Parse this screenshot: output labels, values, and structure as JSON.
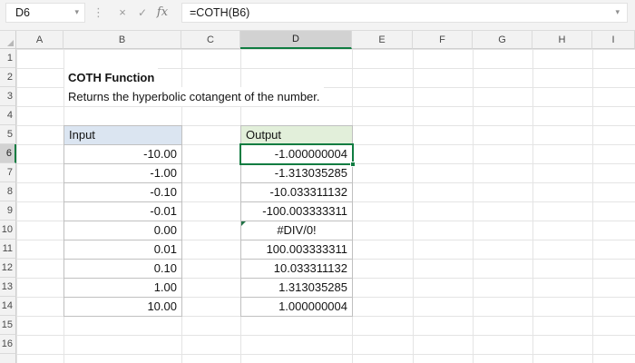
{
  "formula_bar": {
    "name_box_value": "D6",
    "formula": "=COTH(B6)",
    "icons": {
      "name_box_dropdown": "▾",
      "splitter_dots": "⋮",
      "cancel": "×",
      "enter": "✓",
      "insert_function": "fx",
      "expand": "▾"
    }
  },
  "grid": {
    "column_headers": [
      "A",
      "B",
      "C",
      "D",
      "E",
      "F",
      "G",
      "H",
      "I"
    ],
    "row_headers": [
      "1",
      "2",
      "3",
      "4",
      "5",
      "6",
      "7",
      "8",
      "9",
      "10",
      "11",
      "12",
      "13",
      "14",
      "15",
      "16"
    ],
    "selected_column": "D",
    "selected_row": "6",
    "active_cell": "D6",
    "labels": [
      {
        "ref": "B2",
        "text": "COTH Function",
        "bold": true
      },
      {
        "ref": "B3",
        "text": "Returns the hyperbolic cotangent of the number.",
        "bold": false
      }
    ],
    "tables": [
      {
        "column": "B",
        "header_row": 5,
        "header": "Input",
        "header_fill": "#dbe5f1",
        "values": [
          "-10.00",
          "-1.00",
          "-0.10",
          "-0.01",
          "0.00",
          "0.01",
          "0.10",
          "1.00",
          "10.00"
        ]
      },
      {
        "column": "D",
        "header_row": 5,
        "header": "Output",
        "header_fill": "#e2efda",
        "values": [
          "-1.000000004",
          "-1.313035285",
          "-10.033311132",
          "-100.003333311",
          "#DIV/0!",
          "100.003333311",
          "10.033311132",
          "1.313035285",
          "1.000000004"
        ]
      }
    ]
  },
  "colors": {
    "selection": "#107c41",
    "error_indicator": "#217346",
    "input_header_fill": "#dbe5f1",
    "output_header_fill": "#e2efda"
  }
}
